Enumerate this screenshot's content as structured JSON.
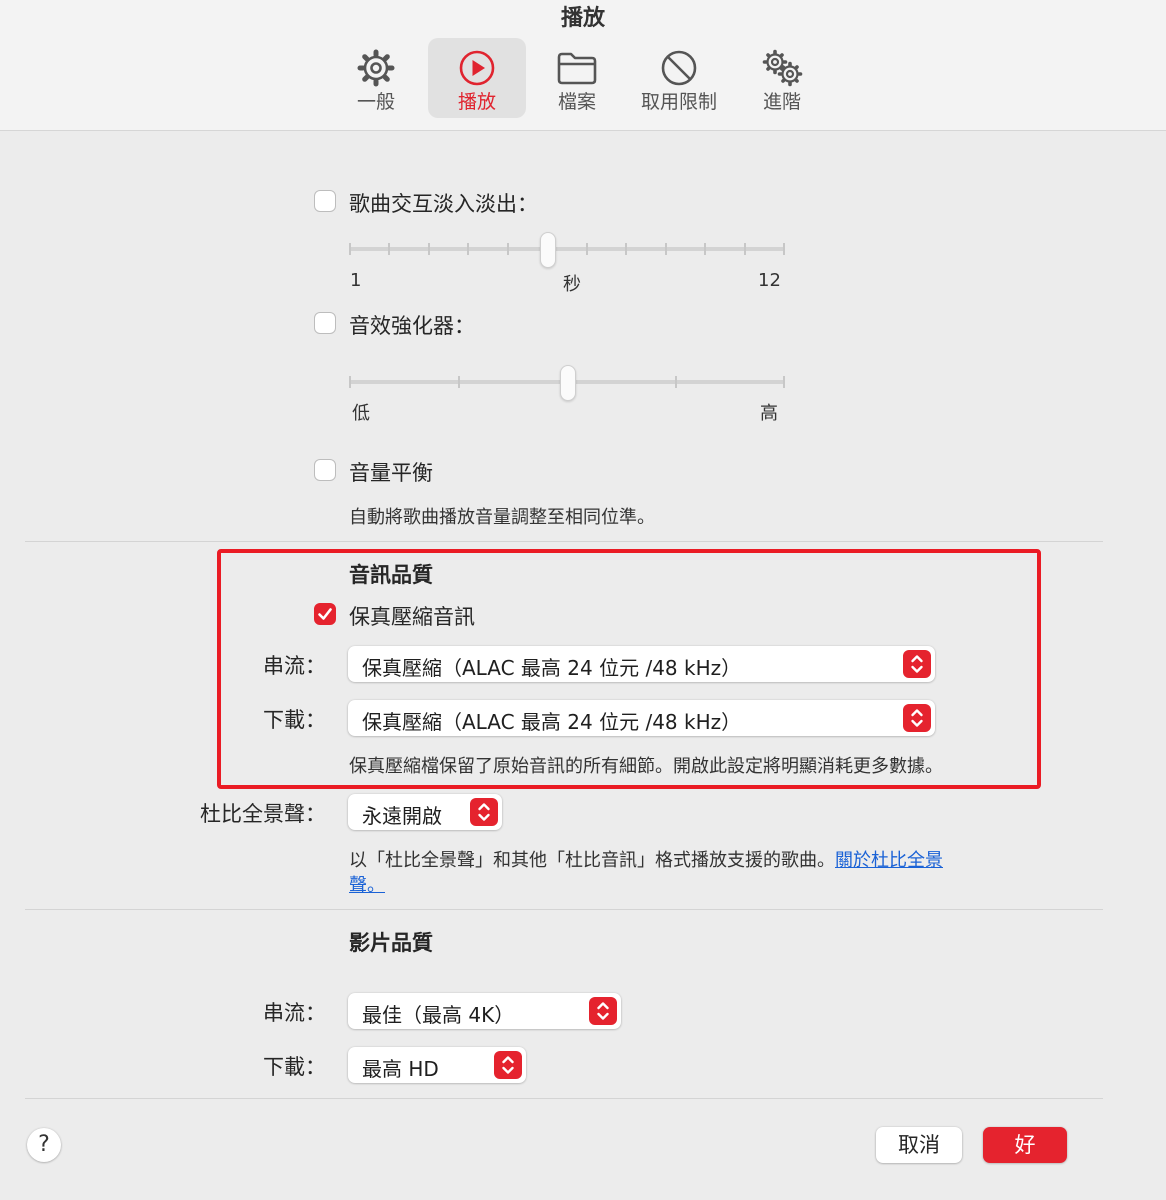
{
  "window": {
    "title": "播放"
  },
  "toolbar": {
    "tabs": [
      {
        "label": "一般",
        "icon": "gear-icon",
        "active": false
      },
      {
        "label": "播放",
        "icon": "play-circle-icon",
        "active": true
      },
      {
        "label": "檔案",
        "icon": "folder-icon",
        "active": false
      },
      {
        "label": "取用限制",
        "icon": "prohibited-icon",
        "active": false
      },
      {
        "label": "進階",
        "icon": "gears-icon",
        "active": false
      }
    ]
  },
  "crossfade": {
    "label": "歌曲交互淡入淡出：",
    "checked": false,
    "min_label": "1",
    "unit_label": "秒",
    "max_label": "12",
    "range": [
      1,
      12
    ],
    "value": 6
  },
  "sound_enhancer": {
    "label": "音效強化器：",
    "checked": false,
    "min_label": "低",
    "max_label": "高",
    "level": 0.5
  },
  "sound_check": {
    "label": "音量平衡",
    "checked": false,
    "description": "自動將歌曲播放音量調整至相同位準。"
  },
  "audio_quality": {
    "title": "音訊品質",
    "lossless": {
      "label": "保真壓縮音訊",
      "checked": true
    },
    "streaming": {
      "label": "串流：",
      "value": "保真壓縮（ALAC 最高 24 位元 /48 kHz）"
    },
    "download": {
      "label": "下載：",
      "value": "保真壓縮（ALAC 最高 24 位元 /48 kHz）"
    },
    "note": "保真壓縮檔保留了原始音訊的所有細節。開啟此設定將明顯消耗更多數據。"
  },
  "dolby": {
    "label": "杜比全景聲：",
    "value": "永遠開啟",
    "description": "以「杜比全景聲」和其他「杜比音訊」格式播放支援的歌曲。",
    "link_line1": "關於杜比全景",
    "link_line2": "聲。"
  },
  "video_quality": {
    "title": "影片品質",
    "streaming": {
      "label": "串流：",
      "value": "最佳（最高 4K）"
    },
    "download": {
      "label": "下載：",
      "value": "最高 HD"
    }
  },
  "footer": {
    "help_label": "?",
    "cancel_label": "取消",
    "ok_label": "好"
  },
  "colors": {
    "accent": "#e5232e",
    "highlight_border": "#ea1b24",
    "link": "#1a62d6"
  }
}
